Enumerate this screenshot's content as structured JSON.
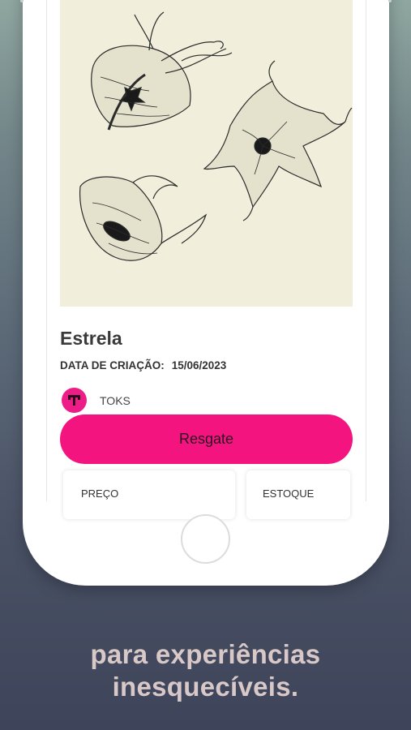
{
  "nft": {
    "title": "Estrela",
    "date_label": "DATA DE CRIAÇÃO:",
    "date_value": "15/06/2023"
  },
  "creator": {
    "name": "TOKS",
    "avatar_letter": "T"
  },
  "actions": {
    "redeem_label": "Resgate"
  },
  "stats": {
    "price_label": "PREÇO",
    "stock_label": "ESTOQUE"
  },
  "promo": {
    "line1": "para experiências",
    "line2": "inesquecíveis."
  },
  "colors": {
    "accent": "#f4147f",
    "artwork_background": "#f1efdc",
    "tagline": "#d8c9c8"
  }
}
